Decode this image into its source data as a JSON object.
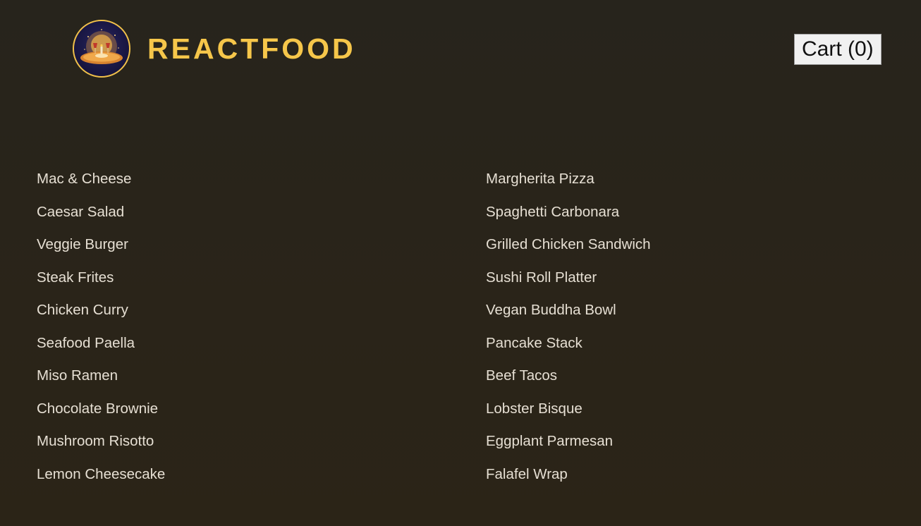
{
  "brand": {
    "name": "REACTFOOD",
    "logo_icon": "restaurant-logo-icon",
    "accent_color": "#f6c64a"
  },
  "cart": {
    "label": "Cart (0)"
  },
  "meals": [
    "Mac & Cheese",
    "Margherita Pizza",
    "Caesar Salad",
    "Spaghetti Carbonara",
    "Veggie Burger",
    "Grilled Chicken Sandwich",
    "Steak Frites",
    "Sushi Roll Platter",
    "Chicken Curry",
    "Vegan Buddha Bowl",
    "Seafood Paella",
    "Pancake Stack",
    "Miso Ramen",
    "Beef Tacos",
    "Chocolate Brownie",
    "Lobster Bisque",
    "Mushroom Risotto",
    "Eggplant Parmesan",
    "Lemon Cheesecake",
    "Falafel Wrap"
  ]
}
